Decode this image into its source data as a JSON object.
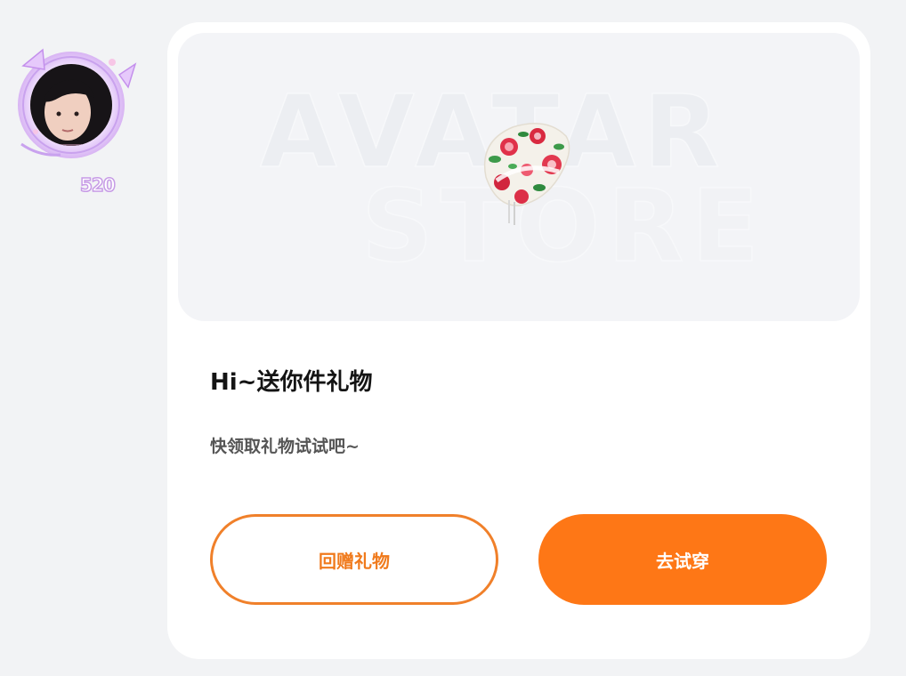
{
  "avatar": {
    "frame_level": "520",
    "icon": "user-avatar-with-decorative-frame"
  },
  "banner": {
    "bg_word_1": "AVATAR",
    "bg_word_2": "STORE",
    "item_icon": "floral-hat-item"
  },
  "gift": {
    "title": "Hi~送你件礼物",
    "subtitle": "快领取礼物试试吧~"
  },
  "buttons": {
    "return_gift_label": "回赠礼物",
    "try_on_label": "去试穿"
  },
  "colors": {
    "accent": "#fe7716",
    "outline": "#f0802a",
    "page_bg": "#f2f3f5",
    "card_bg": "#ffffff"
  }
}
